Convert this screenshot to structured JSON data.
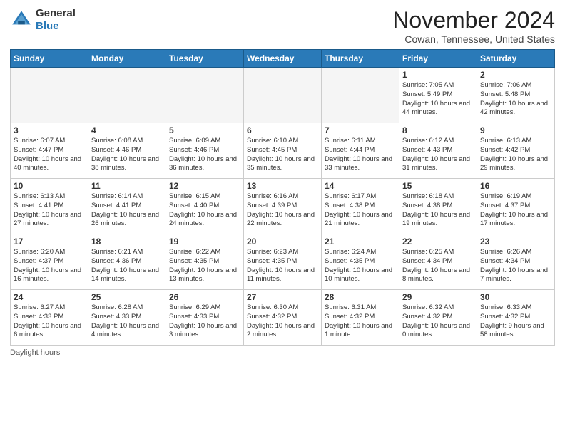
{
  "header": {
    "logo_general": "General",
    "logo_blue": "Blue",
    "month_title": "November 2024",
    "location": "Cowan, Tennessee, United States"
  },
  "days_of_week": [
    "Sunday",
    "Monday",
    "Tuesday",
    "Wednesday",
    "Thursday",
    "Friday",
    "Saturday"
  ],
  "weeks": [
    [
      {
        "day": "",
        "empty": true
      },
      {
        "day": "",
        "empty": true
      },
      {
        "day": "",
        "empty": true
      },
      {
        "day": "",
        "empty": true
      },
      {
        "day": "",
        "empty": true
      },
      {
        "day": "1",
        "sunrise": "7:05 AM",
        "sunset": "5:49 PM",
        "daylight": "10 hours and 44 minutes."
      },
      {
        "day": "2",
        "sunrise": "7:06 AM",
        "sunset": "5:48 PM",
        "daylight": "10 hours and 42 minutes."
      }
    ],
    [
      {
        "day": "3",
        "sunrise": "6:07 AM",
        "sunset": "4:47 PM",
        "daylight": "10 hours and 40 minutes."
      },
      {
        "day": "4",
        "sunrise": "6:08 AM",
        "sunset": "4:46 PM",
        "daylight": "10 hours and 38 minutes."
      },
      {
        "day": "5",
        "sunrise": "6:09 AM",
        "sunset": "4:46 PM",
        "daylight": "10 hours and 36 minutes."
      },
      {
        "day": "6",
        "sunrise": "6:10 AM",
        "sunset": "4:45 PM",
        "daylight": "10 hours and 35 minutes."
      },
      {
        "day": "7",
        "sunrise": "6:11 AM",
        "sunset": "4:44 PM",
        "daylight": "10 hours and 33 minutes."
      },
      {
        "day": "8",
        "sunrise": "6:12 AM",
        "sunset": "4:43 PM",
        "daylight": "10 hours and 31 minutes."
      },
      {
        "day": "9",
        "sunrise": "6:13 AM",
        "sunset": "4:42 PM",
        "daylight": "10 hours and 29 minutes."
      }
    ],
    [
      {
        "day": "10",
        "sunrise": "6:13 AM",
        "sunset": "4:41 PM",
        "daylight": "10 hours and 27 minutes."
      },
      {
        "day": "11",
        "sunrise": "6:14 AM",
        "sunset": "4:41 PM",
        "daylight": "10 hours and 26 minutes."
      },
      {
        "day": "12",
        "sunrise": "6:15 AM",
        "sunset": "4:40 PM",
        "daylight": "10 hours and 24 minutes."
      },
      {
        "day": "13",
        "sunrise": "6:16 AM",
        "sunset": "4:39 PM",
        "daylight": "10 hours and 22 minutes."
      },
      {
        "day": "14",
        "sunrise": "6:17 AM",
        "sunset": "4:38 PM",
        "daylight": "10 hours and 21 minutes."
      },
      {
        "day": "15",
        "sunrise": "6:18 AM",
        "sunset": "4:38 PM",
        "daylight": "10 hours and 19 minutes."
      },
      {
        "day": "16",
        "sunrise": "6:19 AM",
        "sunset": "4:37 PM",
        "daylight": "10 hours and 17 minutes."
      }
    ],
    [
      {
        "day": "17",
        "sunrise": "6:20 AM",
        "sunset": "4:37 PM",
        "daylight": "10 hours and 16 minutes."
      },
      {
        "day": "18",
        "sunrise": "6:21 AM",
        "sunset": "4:36 PM",
        "daylight": "10 hours and 14 minutes."
      },
      {
        "day": "19",
        "sunrise": "6:22 AM",
        "sunset": "4:35 PM",
        "daylight": "10 hours and 13 minutes."
      },
      {
        "day": "20",
        "sunrise": "6:23 AM",
        "sunset": "4:35 PM",
        "daylight": "10 hours and 11 minutes."
      },
      {
        "day": "21",
        "sunrise": "6:24 AM",
        "sunset": "4:35 PM",
        "daylight": "10 hours and 10 minutes."
      },
      {
        "day": "22",
        "sunrise": "6:25 AM",
        "sunset": "4:34 PM",
        "daylight": "10 hours and 8 minutes."
      },
      {
        "day": "23",
        "sunrise": "6:26 AM",
        "sunset": "4:34 PM",
        "daylight": "10 hours and 7 minutes."
      }
    ],
    [
      {
        "day": "24",
        "sunrise": "6:27 AM",
        "sunset": "4:33 PM",
        "daylight": "10 hours and 6 minutes."
      },
      {
        "day": "25",
        "sunrise": "6:28 AM",
        "sunset": "4:33 PM",
        "daylight": "10 hours and 4 minutes."
      },
      {
        "day": "26",
        "sunrise": "6:29 AM",
        "sunset": "4:33 PM",
        "daylight": "10 hours and 3 minutes."
      },
      {
        "day": "27",
        "sunrise": "6:30 AM",
        "sunset": "4:32 PM",
        "daylight": "10 hours and 2 minutes."
      },
      {
        "day": "28",
        "sunrise": "6:31 AM",
        "sunset": "4:32 PM",
        "daylight": "10 hours and 1 minute."
      },
      {
        "day": "29",
        "sunrise": "6:32 AM",
        "sunset": "4:32 PM",
        "daylight": "10 hours and 0 minutes."
      },
      {
        "day": "30",
        "sunrise": "6:33 AM",
        "sunset": "4:32 PM",
        "daylight": "9 hours and 58 minutes."
      }
    ]
  ],
  "footer": {
    "daylight_label": "Daylight hours"
  }
}
